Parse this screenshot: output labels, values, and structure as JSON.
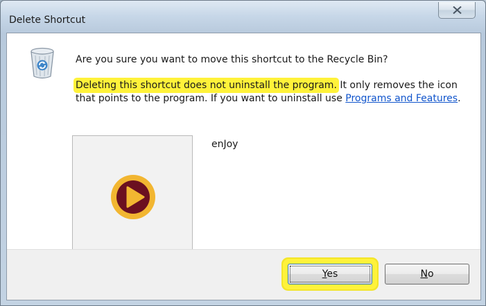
{
  "dialog": {
    "title": "Delete Shortcut",
    "question": "Are you sure you want to move this shortcut to the Recycle Bin?",
    "info_highlighted": "Deleting this shortcut does not uninstall the program.",
    "info_rest": " It only removes the icon that points to the program. If you want to uninstall use ",
    "link_text": "Programs and Features",
    "info_end": ".",
    "item_name": "enJoy",
    "icons": {
      "title_close": "close-icon",
      "recycle_bin": "recycle-bin-icon",
      "item": "play-icon"
    },
    "buttons": {
      "yes_mnemonic": "Y",
      "yes_rest": "es",
      "no_mnemonic": "N",
      "no_rest": "o"
    },
    "colors": {
      "highlight": "#fff23a",
      "link": "#1155cc",
      "play_outer": "#f2b631",
      "play_inner": "#6b1020"
    }
  }
}
